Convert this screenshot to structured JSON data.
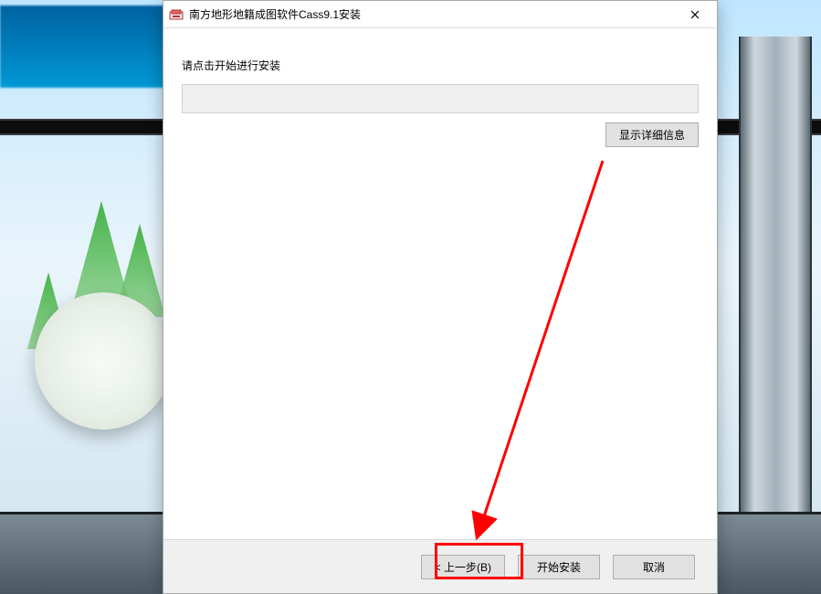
{
  "window": {
    "title": "南方地形地籍成图软件Cass9.1安装"
  },
  "content": {
    "instruction": "请点击开始进行安装",
    "show_details_button": "显示详细信息"
  },
  "footer": {
    "back_button": "< 上一步(B)",
    "start_button": "开始安装",
    "cancel_button": "取消"
  }
}
